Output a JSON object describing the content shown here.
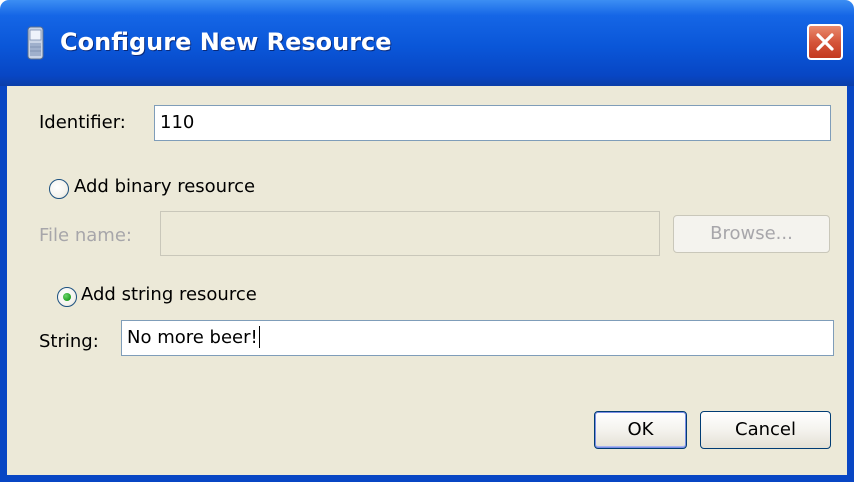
{
  "window": {
    "title": "Configure New Resource",
    "close_label": "close",
    "titlebar_color": "#0a56d8",
    "close_color": "#d5553a"
  },
  "identifier": {
    "label": "Identifier:",
    "value": "110"
  },
  "binary_option": {
    "label": "Add binary resource",
    "selected": false
  },
  "file_name": {
    "label": "File name:",
    "value": "",
    "enabled": false
  },
  "browse_button": {
    "label": "Browse...",
    "enabled": false
  },
  "string_option": {
    "label": "Add string resource",
    "selected": true
  },
  "string_field": {
    "label": "String:",
    "value": "No more beer!"
  },
  "buttons": {
    "ok_label": "OK",
    "cancel_label": "Cancel"
  }
}
